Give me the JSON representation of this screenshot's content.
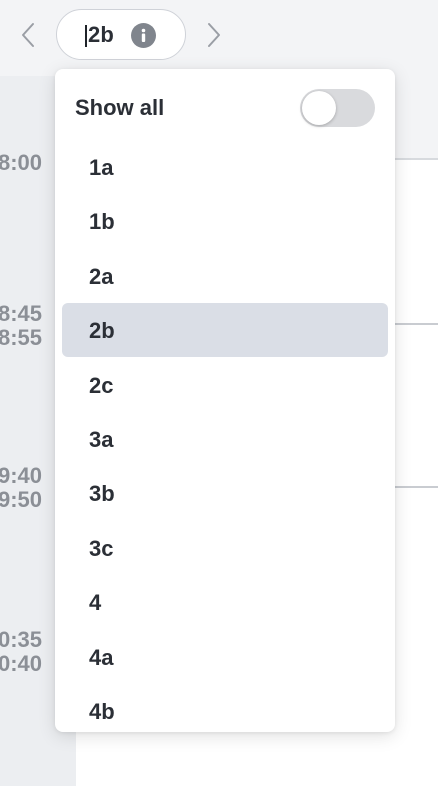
{
  "toolbar": {
    "selected_value": "2b",
    "prev_icon": "chevron-left-icon",
    "next_icon": "chevron-right-icon",
    "info_icon": "info-icon"
  },
  "schedule": {
    "time_labels": [
      "8:00",
      "8:45",
      "8:55",
      "9:40",
      "9:50",
      "0:35",
      "0:40"
    ]
  },
  "dropdown": {
    "show_all_label": "Show all",
    "show_all_enabled": false,
    "options": [
      "1a",
      "1b",
      "2a",
      "2b",
      "2c",
      "3a",
      "3b",
      "3c",
      "4",
      "4a",
      "4b"
    ],
    "selected_index": 3
  },
  "colors": {
    "selected_bg": "#dadee6",
    "toggle_off": "#d9dadd",
    "event_accent": "#b5b02c"
  }
}
